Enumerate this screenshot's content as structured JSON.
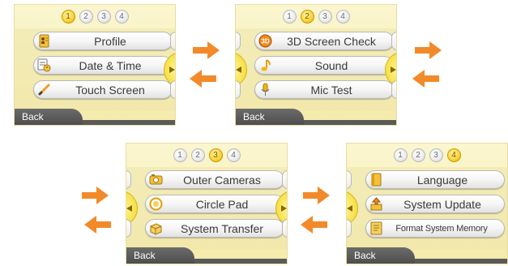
{
  "colors": {
    "arrow": "#f28a2a",
    "active_dot": "#f7d23a",
    "back_tab": "#575757"
  },
  "screens": [
    {
      "pager": [
        "1",
        "2",
        "3",
        "4"
      ],
      "active_page": 1,
      "items": [
        {
          "label": "Profile",
          "icon": "profile-card-icon"
        },
        {
          "label": "Date & Time",
          "icon": "calendar-clock-icon"
        },
        {
          "label": "Touch Screen",
          "icon": "stylus-icon"
        }
      ],
      "back_label": "Back"
    },
    {
      "pager": [
        "1",
        "2",
        "3",
        "4"
      ],
      "active_page": 2,
      "items": [
        {
          "label": "3D Screen Check",
          "icon": "3d-icon"
        },
        {
          "label": "Sound",
          "icon": "music-note-icon"
        },
        {
          "label": "Mic Test",
          "icon": "microphone-icon"
        }
      ],
      "back_label": "Back"
    },
    {
      "pager": [
        "1",
        "2",
        "3",
        "4"
      ],
      "active_page": 3,
      "items": [
        {
          "label": "Outer Cameras",
          "icon": "camera-icon"
        },
        {
          "label": "Circle Pad",
          "icon": "circle-pad-icon"
        },
        {
          "label": "System Transfer",
          "icon": "transfer-box-icon"
        }
      ],
      "back_label": "Back"
    },
    {
      "pager": [
        "1",
        "2",
        "3",
        "4"
      ],
      "active_page": 4,
      "items": [
        {
          "label": "Language",
          "icon": "book-icon"
        },
        {
          "label": "System Update",
          "icon": "update-icon"
        },
        {
          "label": "Format System Memory",
          "icon": "format-memory-icon"
        }
      ],
      "back_label": "Back"
    }
  ]
}
